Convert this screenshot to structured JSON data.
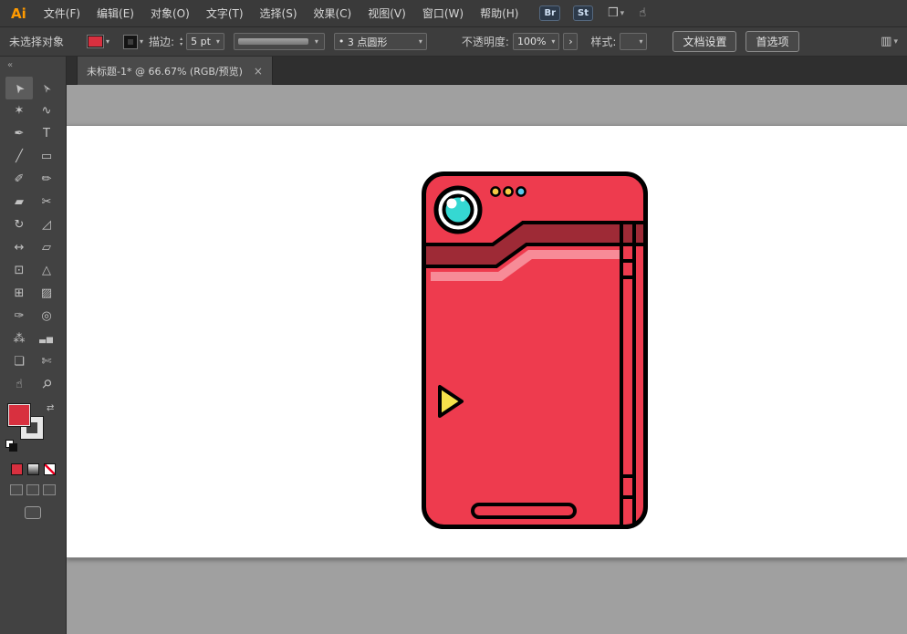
{
  "app": {
    "logo": "Ai"
  },
  "menu": {
    "items": [
      "文件(F)",
      "编辑(E)",
      "对象(O)",
      "文字(T)",
      "选择(S)",
      "效果(C)",
      "视图(V)",
      "窗口(W)",
      "帮助(H)"
    ],
    "bridge": "Br",
    "stock": "St"
  },
  "icons": {
    "caret": "▾",
    "caret_up": "▴",
    "chevron_right": "›",
    "collapse": "«",
    "swap": "⇄",
    "arrange": "❒",
    "touch": "☝",
    "bullet": "•",
    "panel": "▥"
  },
  "control_bar": {
    "status": "未选择对象",
    "stroke_label": "描边:",
    "stroke_value": "5 pt",
    "brush_value": "3 点圆形",
    "opacity_label": "不透明度:",
    "opacity_value": "100%",
    "style_label": "样式:",
    "document_setup": "文档设置",
    "preferences": "首选项"
  },
  "document_tab": {
    "title": "未标题-1* @ 66.67%  (RGB/预览)",
    "close_label": "×"
  },
  "tools": [
    {
      "name": "selection-tool",
      "glyph": "➤"
    },
    {
      "name": "direct-selection-tool",
      "glyph": "➢"
    },
    {
      "name": "magic-wand-tool",
      "glyph": "✶"
    },
    {
      "name": "lasso-tool",
      "glyph": "∿"
    },
    {
      "name": "pen-tool",
      "glyph": "✒"
    },
    {
      "name": "type-tool",
      "glyph": "T"
    },
    {
      "name": "line-segment-tool",
      "glyph": "╱"
    },
    {
      "name": "rectangle-tool",
      "glyph": "▭"
    },
    {
      "name": "paintbrush-tool",
      "glyph": "✐"
    },
    {
      "name": "pencil-tool",
      "glyph": "✏"
    },
    {
      "name": "eraser-tool",
      "glyph": "▰"
    },
    {
      "name": "scissors-tool",
      "glyph": "✂"
    },
    {
      "name": "rotate-tool",
      "glyph": "↻"
    },
    {
      "name": "scale-tool",
      "glyph": "◿"
    },
    {
      "name": "width-tool",
      "glyph": "↔"
    },
    {
      "name": "free-transform-tool",
      "glyph": "▱"
    },
    {
      "name": "shape-builder-tool",
      "glyph": "⊡"
    },
    {
      "name": "perspective-grid-tool",
      "glyph": "△"
    },
    {
      "name": "mesh-tool",
      "glyph": "⊞"
    },
    {
      "name": "gradient-tool",
      "glyph": "▨"
    },
    {
      "name": "eyedropper-tool",
      "glyph": "✑"
    },
    {
      "name": "blend-tool",
      "glyph": "◎"
    },
    {
      "name": "symbol-sprayer-tool",
      "glyph": "⁂"
    },
    {
      "name": "column-graph-tool",
      "glyph": "▃▅"
    },
    {
      "name": "artboard-tool",
      "glyph": "❏"
    },
    {
      "name": "slice-tool",
      "glyph": "✄"
    },
    {
      "name": "hand-tool",
      "glyph": "☝"
    },
    {
      "name": "zoom-tool",
      "glyph": "⚲"
    }
  ],
  "artwork": {
    "description": "red pokedex-style device illustration",
    "colors": {
      "red": "#ee3b4e",
      "maroon": "#9e2a36",
      "pink": "#f78b97",
      "cyan": "#35d8d2",
      "white": "#ffffff",
      "gold": "#f6c944",
      "blue": "#5ac8ea",
      "yellow": "#f6e14b",
      "outline": "#000000"
    }
  }
}
